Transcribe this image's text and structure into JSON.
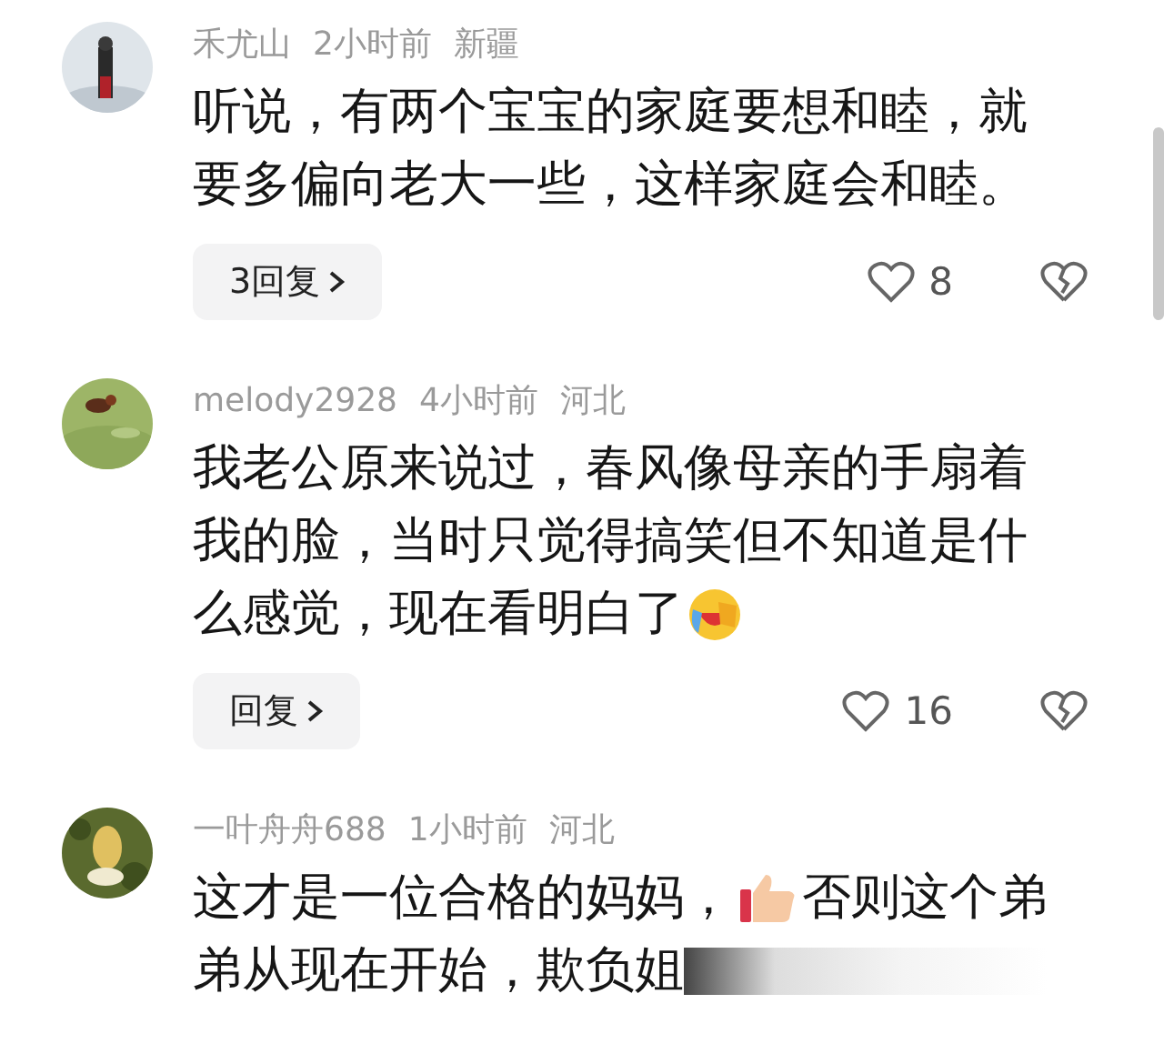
{
  "comments": [
    {
      "avatar": {
        "kind": "picture"
      },
      "user": "禾尤山",
      "time": "2小时前",
      "region": "新疆",
      "lines": [
        [
          {
            "kind": "text",
            "text": "听说，有两个宝宝的家庭要想和睦，就"
          }
        ],
        [
          {
            "kind": "text",
            "text": "要多偏向老大一些，这样家庭会和睦。"
          }
        ]
      ],
      "reply_label": "3回复",
      "likes": "8",
      "faded": false
    },
    {
      "avatar": {
        "kind": "picture"
      },
      "user": "melody2928",
      "time": "4小时前",
      "region": "河北",
      "lines": [
        [
          {
            "kind": "text",
            "text": "我老公原来说过，春风像母亲的手扇着"
          }
        ],
        [
          {
            "kind": "text",
            "text": "我的脸，当时只觉得搞笑但不知道是什"
          }
        ],
        [
          {
            "kind": "text",
            "text": "么感觉，现在看明白了"
          },
          {
            "kind": "laughing_emoji"
          }
        ]
      ],
      "reply_label": "回复",
      "likes": "16",
      "faded": false
    },
    {
      "avatar": {
        "kind": "picture"
      },
      "user": "一叶舟舟688",
      "time": "1小时前",
      "region": "河北",
      "lines": [
        [
          {
            "kind": "text",
            "text": "这才是一位合格的妈妈，"
          },
          {
            "kind": "thumbs_up_emoji"
          },
          {
            "kind": "text",
            "text": "否则这个弟"
          }
        ],
        [
          {
            "kind": "text",
            "text": "弟从现在开始，欺负姐"
          }
        ]
      ],
      "faded": true
    }
  ]
}
